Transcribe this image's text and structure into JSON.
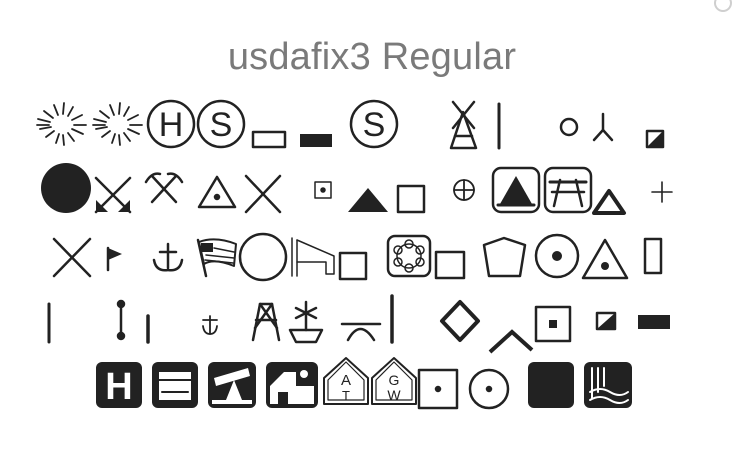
{
  "font_name": "usdafix3 Regular",
  "ink_color": "#222222",
  "title_color": "#7a7a7a",
  "glyph_rows": [
    [
      "sunburst-icon",
      "sunburst-icon",
      "hospital-circle-icon",
      "s-circle-icon",
      "rectangle-outline-icon",
      "rectangle-filled-icon",
      "s-circle-icon",
      "windmill-icon",
      "vertical-bar-icon",
      "circle-small-icon",
      "y-junction-icon",
      "square-half-icon"
    ],
    [
      "circle-filled-icon",
      "crossed-arrows-icon",
      "crossed-picks-icon",
      "triangle-dot-icon",
      "x-mark-icon",
      "square-dot-icon",
      "triangle-filled-icon",
      "square-outline-icon",
      "circle-plus-icon",
      "tent-box-icon",
      "picnic-table-box-icon",
      "small-tent-icon",
      "plus-icon"
    ],
    [
      "x-mark-icon",
      "flag-icon",
      "anchor-icon",
      "us-flag-icon",
      "circle-outline-icon",
      "ski-lift-icon",
      "square-outline-icon",
      "snowflake-box-icon",
      "square-outline-icon",
      "pentagon-icon",
      "circle-dot-icon",
      "triangle-dot-icon",
      "rectangle-tall-icon"
    ],
    [
      "vertical-bar-icon",
      "dumbbell-icon",
      "vertical-bar-icon",
      "anchor-small-icon",
      "tower-icon",
      "plant-pot-icon",
      "mine-icon",
      "diamond-icon",
      "chevron-up-icon",
      "square-dot-icon",
      "square-half-icon",
      "bar-filled-icon"
    ],
    [
      "hospital-box-icon",
      "mailbox-icon",
      "oil-pump-icon",
      "building-box-icon",
      "at-shield-icon",
      "gw-shield-icon",
      "square-dot-icon",
      "circle-dot-icon",
      "square-filled-icon",
      "water-box-icon"
    ]
  ],
  "shield_letters": {
    "hospital": "H",
    "s_circle": "S",
    "at": [
      "A",
      "T"
    ],
    "gw": [
      "G",
      "W"
    ]
  }
}
